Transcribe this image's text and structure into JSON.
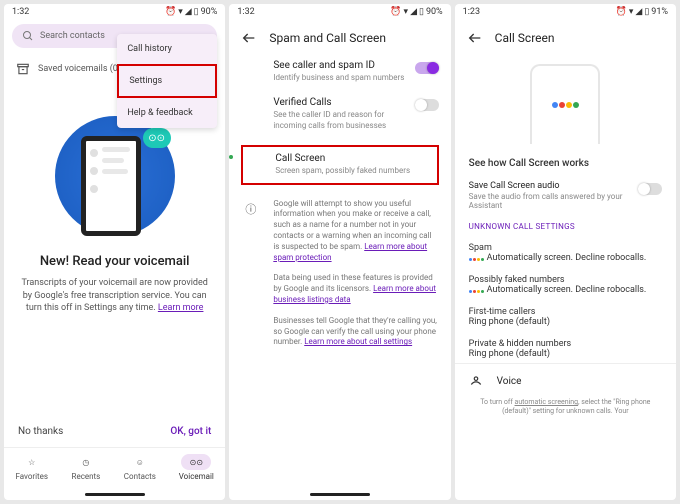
{
  "status": {
    "time1": "1:32",
    "time2": "1:32",
    "time3": "1:23",
    "battery": "90%",
    "battery3": "91%"
  },
  "phone1": {
    "search_placeholder": "Search contacts",
    "menu": {
      "call_history": "Call history",
      "settings": "Settings",
      "help": "Help & feedback"
    },
    "voicemail_row": "Saved voicemails (0)",
    "headline": "New! Read your voicemail",
    "body_a": "Transcripts of your voicemail are now provided by Google's free transcription service. You can turn this off in Settings any time. ",
    "learn_more": "Learn more",
    "no_thanks": "No thanks",
    "ok": "OK, got it",
    "nav": {
      "favorites": "Favorites",
      "recents": "Recents",
      "contacts": "Contacts",
      "voicemail": "Voicemail"
    }
  },
  "phone2": {
    "title": "Spam and Call Screen",
    "row1": {
      "label": "See caller and spam ID",
      "sub": "Identify business and spam numbers"
    },
    "row2": {
      "label": "Verified Calls",
      "sub": "See the caller ID and reason for incoming calls from businesses"
    },
    "row3": {
      "label": "Call Screen",
      "sub": "Screen spam, possibly faked numbers"
    },
    "info1": "Google will attempt to show you useful information when you make or receive a call, such as a name for a number not in your contacts or a warning when an incoming call is suspected to be spam. ",
    "info1_link": "Learn more about spam protection",
    "info2": "Data being used in these features is provided by Google and its licensors. ",
    "info2_link": "Learn more about business listings data",
    "info3": "Businesses tell Google that they're calling you, so Google can verify the call using your phone number. ",
    "info3_link": "Learn more about call settings"
  },
  "phone3": {
    "title": "Call Screen",
    "see_how": "See how Call Screen works",
    "save_audio": {
      "label": "Save Call Screen audio",
      "sub": "Save the audio from calls answered by your Assistant"
    },
    "unknown_settings": "UNKNOWN CALL SETTINGS",
    "spam": {
      "label": "Spam",
      "sub": "Automatically screen. Decline robocalls."
    },
    "faked": {
      "label": "Possibly faked numbers",
      "sub": "Automatically screen. Decline robocalls."
    },
    "first": {
      "label": "First-time callers",
      "sub": "Ring phone (default)"
    },
    "private": {
      "label": "Private & hidden numbers",
      "sub": "Ring phone (default)"
    },
    "voice": "Voice",
    "footnote_a": "To turn off ",
    "footnote_u": "automatic screening",
    "footnote_b": ", select the \"Ring phone (default)\" setting for unknown calls. Your"
  }
}
